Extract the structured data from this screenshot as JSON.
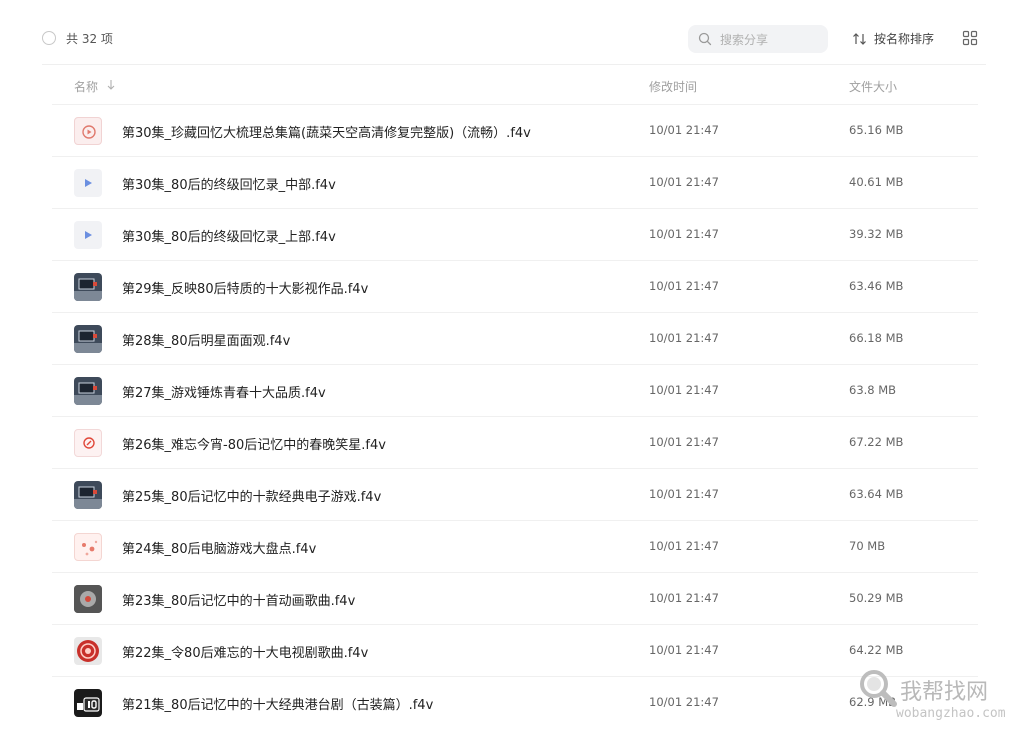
{
  "toolbar": {
    "count_label": "共 32 项",
    "search_placeholder": "搜索分享",
    "sort_label": "按名称排序"
  },
  "columns": {
    "name": "名称",
    "modified": "修改时间",
    "size": "文件大小"
  },
  "files": [
    {
      "name": "第30集_珍藏回忆大梳理总集篇(蔬菜天空高清修复完整版)（流畅）.f4v",
      "time": "10/01 21:47",
      "size": "65.16 MB",
      "thumb": "doc-icon"
    },
    {
      "name": "第30集_80后的终级回忆录_中部.f4v",
      "time": "10/01 21:47",
      "size": "40.61 MB",
      "thumb": "video-play-icon"
    },
    {
      "name": "第30集_80后的终级回忆录_上部.f4v",
      "time": "10/01 21:47",
      "size": "39.32 MB",
      "thumb": "video-play-icon"
    },
    {
      "name": "第29集_反映80后特质的十大影视作品.f4v",
      "time": "10/01 21:47",
      "size": "63.46 MB",
      "thumb": "video-thumbnail"
    },
    {
      "name": "第28集_80后明星面面观.f4v",
      "time": "10/01 21:47",
      "size": "66.18 MB",
      "thumb": "video-thumbnail"
    },
    {
      "name": "第27集_游戏锤炼青春十大品质.f4v",
      "time": "10/01 21:47",
      "size": "63.8 MB",
      "thumb": "video-thumbnail"
    },
    {
      "name": "第26集_难忘今宵-80后记忆中的春晚笑星.f4v",
      "time": "10/01 21:47",
      "size": "67.22 MB",
      "thumb": "red-logo-thumbnail"
    },
    {
      "name": "第25集_80后记忆中的十款经典电子游戏.f4v",
      "time": "10/01 21:47",
      "size": "63.64 MB",
      "thumb": "video-thumbnail"
    },
    {
      "name": "第24集_80后电脑游戏大盘点.f4v",
      "time": "10/01 21:47",
      "size": "70 MB",
      "thumb": "pink-thumbnail"
    },
    {
      "name": "第23集_80后记忆中的十首动画歌曲.f4v",
      "time": "10/01 21:47",
      "size": "50.29 MB",
      "thumb": "grey-thumbnail"
    },
    {
      "name": "第22集_令80后难忘的十大电视剧歌曲.f4v",
      "time": "10/01 21:47",
      "size": "64.22 MB",
      "thumb": "red-circle-thumbnail"
    },
    {
      "name": "第21集_80后记忆中的十大经典港台剧（古装篇）.f4v",
      "time": "10/01 21:47",
      "size": "62.9 MB",
      "thumb": "top10-thumbnail"
    }
  ],
  "watermark": {
    "text": "我帮找网",
    "url": "wobangzhao.com"
  }
}
